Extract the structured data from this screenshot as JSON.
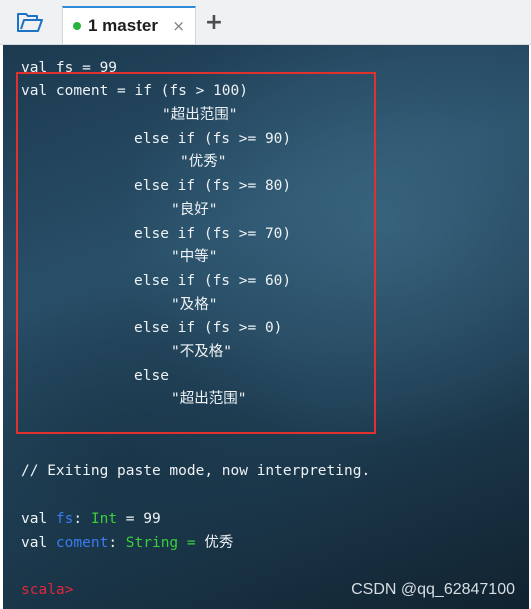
{
  "tabbar": {
    "folder_icon": "folder-open-icon",
    "tab": {
      "label": "1 master",
      "status_color": "#27b33e",
      "close_glyph": "×"
    },
    "new_tab_glyph": "+"
  },
  "terminal": {
    "line_fs": "val fs = 99",
    "code": [
      "val coment = if (fs > 100)",
      "\"超出范围\"",
      "else if (fs >= 90)",
      "\"优秀\"",
      "else if (fs >= 80)",
      "\"良好\"",
      "else if (fs >= 70)",
      "\"中等\"",
      "else if (fs >= 60)",
      "\"及格\"",
      "else if (fs >= 0)",
      "\"不及格\"",
      "else",
      "\"超出范围\""
    ],
    "exiting": "// Exiting paste mode, now interpreting.",
    "result1": {
      "val": "val ",
      "name": "fs",
      "sep": ": ",
      "type": "Int",
      "rest": " = 99"
    },
    "result2": {
      "val": "val ",
      "name": "coment",
      "sep": ": ",
      "type": "String",
      "eq": " = ",
      "value": "优秀"
    },
    "prompt": "scala>"
  },
  "watermark": "CSDN @qq_62847100",
  "colors": {
    "highlight_border": "#e1312e",
    "tab_accent": "#2e8bd8"
  }
}
